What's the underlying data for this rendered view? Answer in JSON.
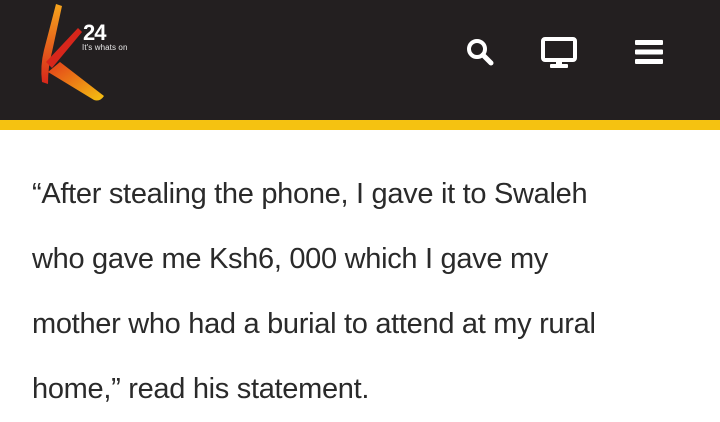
{
  "header": {
    "logo": {
      "brand": "K24",
      "mark": "24",
      "tagline": "It's whats on"
    },
    "icons": {
      "search": "search-icon",
      "tv": "tv-icon",
      "menu": "menu-icon"
    }
  },
  "colors": {
    "header_bg": "#231f20",
    "accent": "#f5c211",
    "logo_red": "#d7261b",
    "logo_orange": "#f28a1a",
    "text": "#2a2a2a"
  },
  "article": {
    "lines": [
      "“After stealing the phone, I gave it to Swaleh",
      "who gave me Ksh6, 000 which I gave my",
      "mother who had a burial to attend at my rural",
      "home,” read his statement."
    ]
  }
}
